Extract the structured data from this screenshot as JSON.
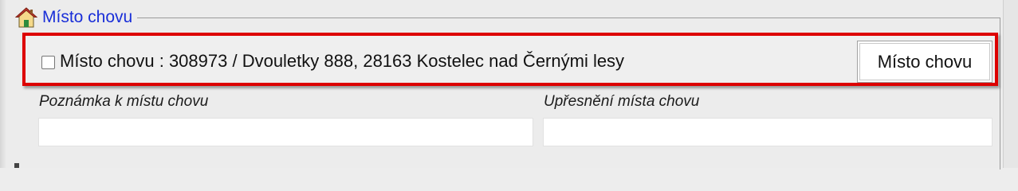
{
  "section": {
    "title": "Místo chovu",
    "icon": "home-icon",
    "icon_colors": {
      "roof": "#c0392b",
      "wall": "#f5d98a",
      "door": "#2e8b3e"
    }
  },
  "row": {
    "checked": false,
    "text": "Místo chovu : 308973 / Dvouletky 888, 28163 Kostelec nad Černými lesy",
    "button_label": "Místo chovu"
  },
  "fields": {
    "note_label": "Poznámka k místu chovu",
    "note_value": "",
    "spec_label": "Upřesnění místa chovu",
    "spec_value": ""
  },
  "colors": {
    "highlight_border": "#dd0000",
    "legend_text": "#1a2fd8"
  }
}
